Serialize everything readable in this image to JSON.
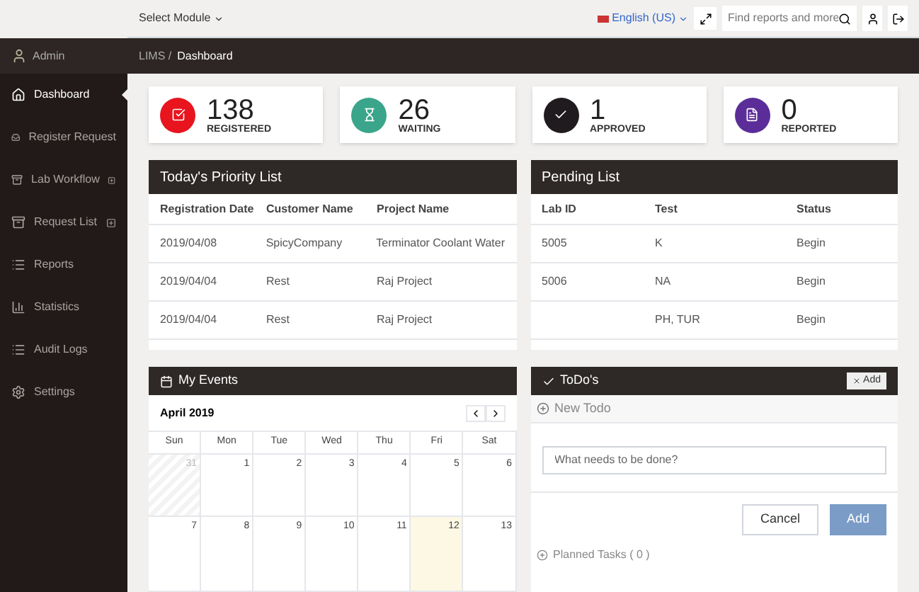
{
  "topbar": {
    "module_select": "Select Module",
    "language": "English (US)",
    "search": {
      "placeholder": "Find reports and more"
    }
  },
  "sidebar": {
    "user": "Admin",
    "items": [
      {
        "label": "Dashboard",
        "kind": "home",
        "selected": true,
        "expandable": false
      },
      {
        "label": "Register Request",
        "kind": "inbox",
        "selected": false,
        "expandable": false
      },
      {
        "label": "Lab Workflow",
        "kind": "archive",
        "selected": false,
        "expandable": true
      },
      {
        "label": "Request List",
        "kind": "archive",
        "selected": false,
        "expandable": true
      },
      {
        "label": "Reports",
        "kind": "list",
        "selected": false,
        "expandable": false
      },
      {
        "label": "Statistics",
        "kind": "chart",
        "selected": false,
        "expandable": false
      },
      {
        "label": "Audit Logs",
        "kind": "list",
        "selected": false,
        "expandable": false
      },
      {
        "label": "Settings",
        "kind": "cogs",
        "selected": false,
        "expandable": false
      }
    ]
  },
  "breadcrumb": {
    "parent": "LIMS /",
    "current": "Dashboard"
  },
  "stats": [
    {
      "value": "138",
      "label": "REGISTERED",
      "kind": "check",
      "color": "#e8141e"
    },
    {
      "value": "26",
      "label": "WAITING",
      "kind": "hourglass",
      "color": "#3aa58a"
    },
    {
      "value": "1",
      "label": "APPROVED",
      "kind": "tick",
      "color": "#1f1b1e"
    },
    {
      "value": "0",
      "label": "REPORTED",
      "kind": "file",
      "color": "#5b2d99"
    }
  ],
  "priority_list": {
    "title": "Today's Priority List",
    "columns": [
      "Registration Date",
      "Customer Name",
      "Project Name"
    ],
    "rows": [
      [
        "2019/04/08",
        "SpicyCompany",
        "Terminator Coolant Water"
      ],
      [
        "2019/04/04",
        "Rest",
        "Raj Project"
      ],
      [
        "2019/04/04",
        "Rest",
        "Raj Project"
      ]
    ]
  },
  "pending_list": {
    "title": "Pending List",
    "columns": [
      "Lab ID",
      "Test",
      "Status"
    ],
    "rows": [
      [
        "5005",
        "K",
        "Begin"
      ],
      [
        "5006",
        "NA",
        "Begin"
      ],
      [
        "",
        "PH, TUR",
        "Begin"
      ]
    ]
  },
  "events": {
    "title": "My Events",
    "month": "April 2019",
    "weekdays": [
      "Sun",
      "Mon",
      "Tue",
      "Wed",
      "Thu",
      "Fri",
      "Sat"
    ],
    "weeks": [
      [
        {
          "day": "31",
          "other_month": true,
          "today": false
        },
        {
          "day": "1",
          "other_month": false,
          "today": false
        },
        {
          "day": "2",
          "other_month": false,
          "today": false
        },
        {
          "day": "3",
          "other_month": false,
          "today": false
        },
        {
          "day": "4",
          "other_month": false,
          "today": false
        },
        {
          "day": "5",
          "other_month": false,
          "today": false
        },
        {
          "day": "6",
          "other_month": false,
          "today": false
        }
      ],
      [
        {
          "day": "7",
          "other_month": false,
          "today": false
        },
        {
          "day": "8",
          "other_month": false,
          "today": false
        },
        {
          "day": "9",
          "other_month": false,
          "today": false
        },
        {
          "day": "10",
          "other_month": false,
          "today": false
        },
        {
          "day": "11",
          "other_month": false,
          "today": false
        },
        {
          "day": "12",
          "other_month": false,
          "today": true
        },
        {
          "day": "13",
          "other_month": false,
          "today": false
        }
      ]
    ]
  },
  "todos": {
    "title": "ToDo's",
    "header_button": "Add",
    "new_todo": "New Todo",
    "input": {
      "placeholder": "What needs to be done?"
    },
    "cancel": "Cancel",
    "add": "Add",
    "planned": "Planned Tasks ( 0 )"
  }
}
